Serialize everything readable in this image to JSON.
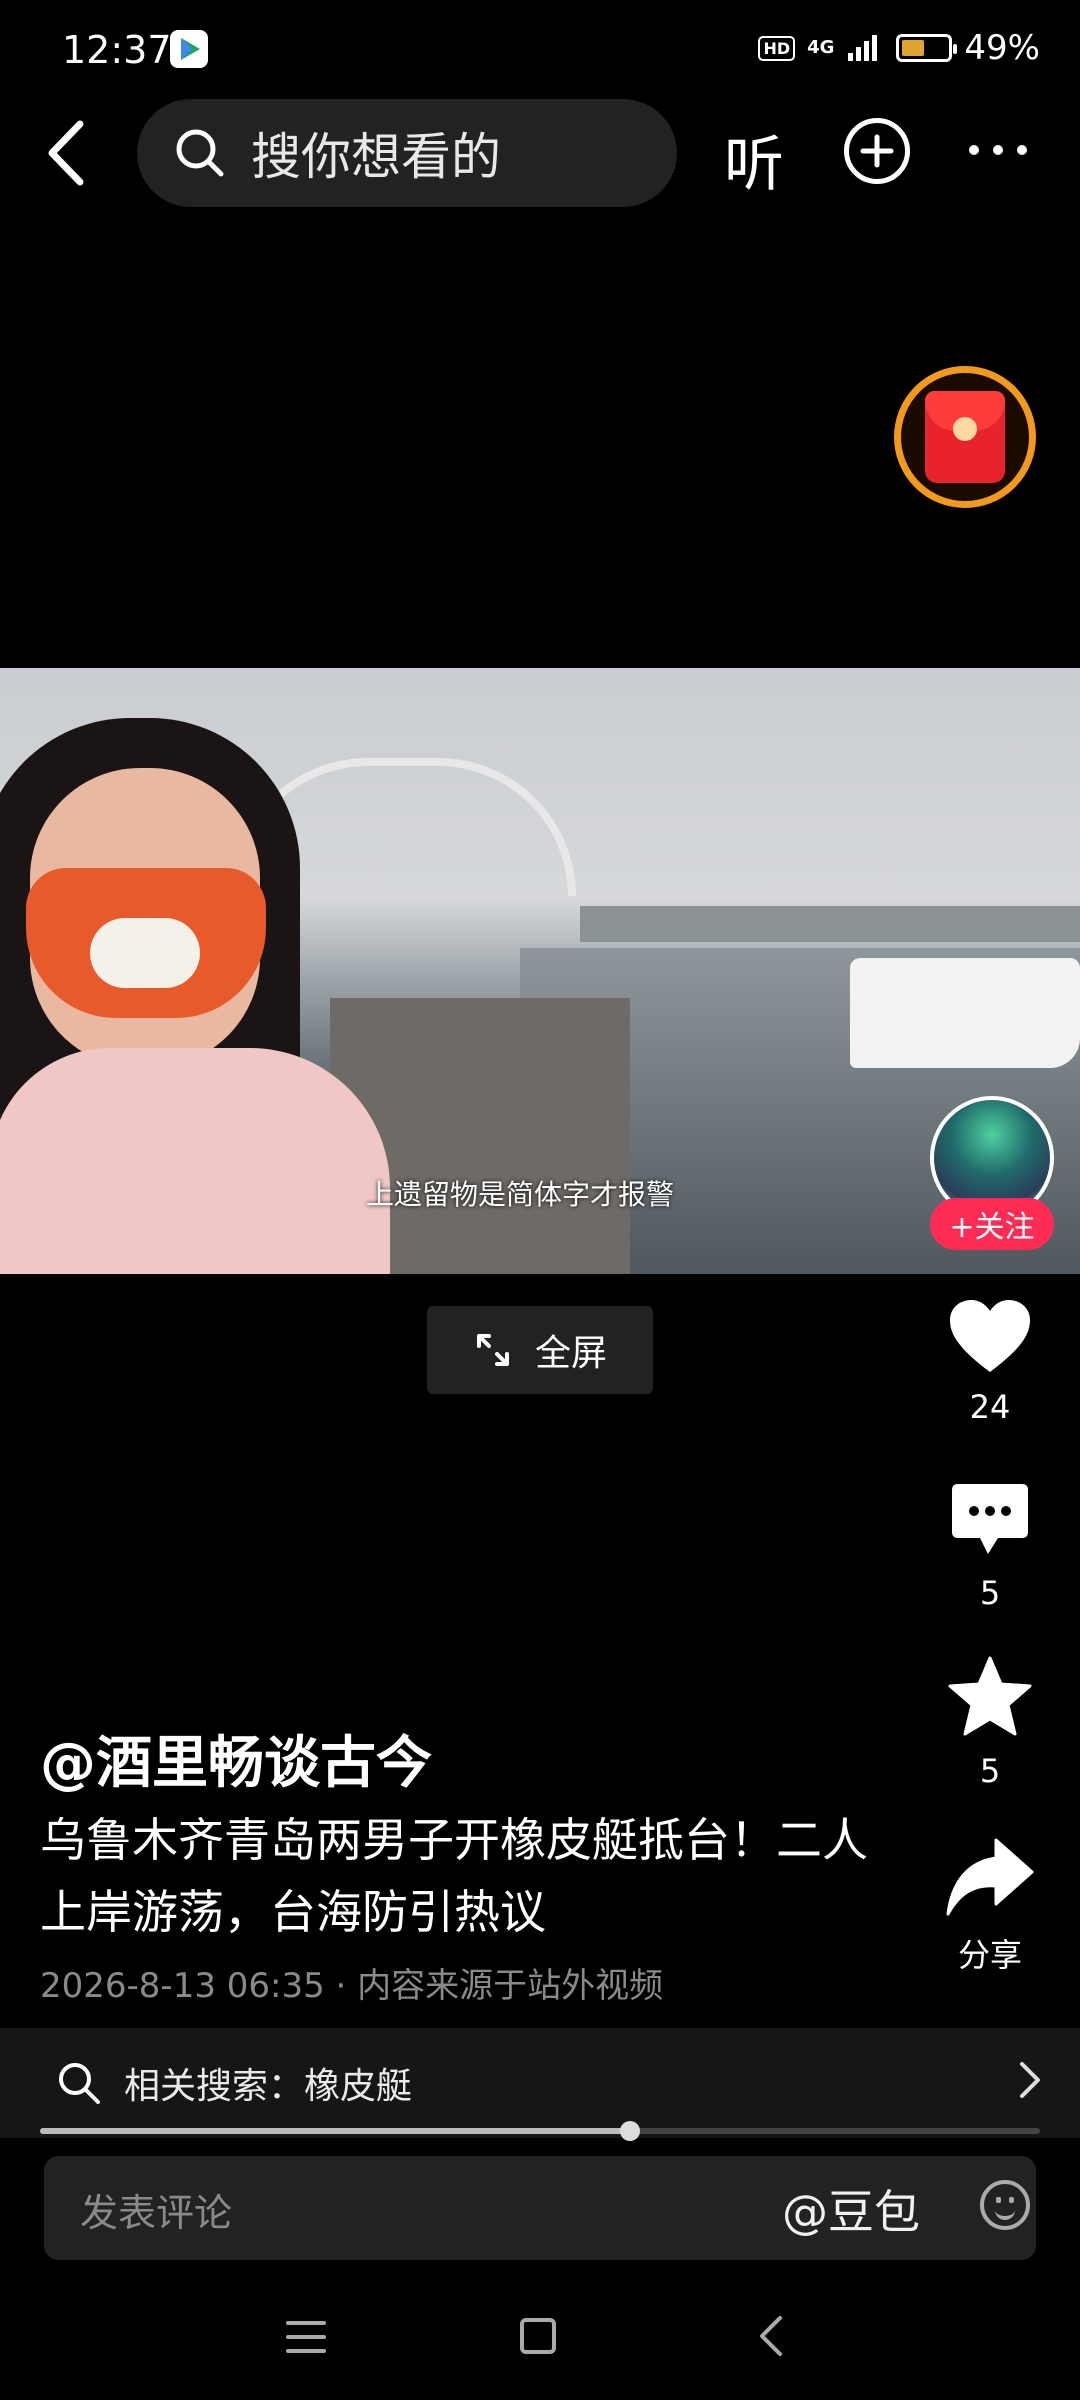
{
  "status_bar": {
    "time": "12:37",
    "hd": "HD",
    "network": "4G",
    "battery": "49%",
    "battery_level": 0.49
  },
  "top_nav": {
    "search_placeholder": "搜你想看的",
    "listen_label": "听"
  },
  "video": {
    "subtitle": "上遗留物是简体字才报警",
    "fullscreen_label": "全屏"
  },
  "follow_label": "+关注",
  "actions": {
    "likes": "24",
    "comments": "5",
    "favorites": "5",
    "share_label": "分享"
  },
  "post": {
    "author": "@酒里畅谈古今",
    "title": "乌鲁木齐青岛两男子开橡皮艇抵台！二人上岸游荡，台海防引热议",
    "meta": "2026-8-13 06:35 · 内容来源于站外视频"
  },
  "related_search": {
    "label": "相关搜索：橡皮艇"
  },
  "playback_progress": 0.59,
  "comment_bar": {
    "placeholder": "发表评论",
    "doubao": "@豆包"
  },
  "colors": {
    "accent": "#fe2c55",
    "redpacket_ring": "#f39a1a",
    "background": "#000000"
  }
}
